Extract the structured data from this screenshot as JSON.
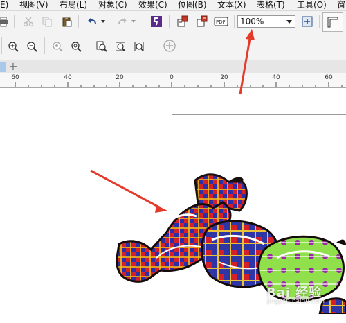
{
  "menubar": {
    "items": [
      {
        "label": "E)",
        "name": "menu-edit-partial"
      },
      {
        "label": "视图(V)",
        "name": "menu-view"
      },
      {
        "label": "布局(L)",
        "name": "menu-layout"
      },
      {
        "label": "对象(C)",
        "name": "menu-object"
      },
      {
        "label": "效果(C)",
        "name": "menu-effects"
      },
      {
        "label": "位图(B)",
        "name": "menu-bitmaps"
      },
      {
        "label": "文本(X)",
        "name": "menu-text"
      },
      {
        "label": "表格(T)",
        "name": "menu-table"
      },
      {
        "label": "工具(O)",
        "name": "menu-tools"
      },
      {
        "label": "窗",
        "name": "menu-window-partial"
      }
    ]
  },
  "toolbar": {
    "zoom_value": "100%"
  },
  "ruler": {
    "ticks": [
      "60",
      "40",
      "20",
      "0",
      "20",
      "40",
      "60"
    ]
  },
  "watermark": {
    "text": "Bai 经验",
    "sub": "jingyan.baidu.com"
  },
  "colors": {
    "toolbar_bg": "#f3f3f3",
    "arrow_red": "#e53a2a",
    "accent_purple": "#5a2b8a"
  }
}
